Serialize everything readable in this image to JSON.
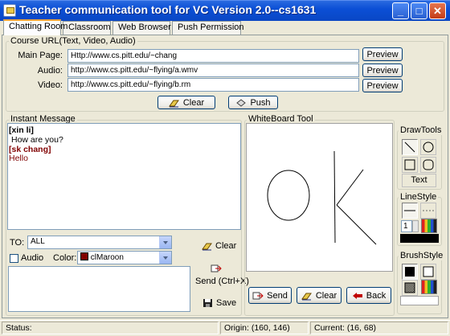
{
  "window": {
    "title": "Teacher communication tool for VC  Version 2.0--cs1631"
  },
  "tabs": [
    "Chatting Room",
    "Classroom",
    "Web Browser",
    "Push Permission"
  ],
  "course_url": {
    "group_label": "Course URL(Text, Video, Audio)",
    "main_page_label": "Main Page:",
    "main_page_value": "Http://www.cs.pitt.edu/~chang",
    "audio_label": "Audio:",
    "audio_value": "http://www.cs.pitt.edu/~flying/a.wmv",
    "video_label": "Video:",
    "video_value": "http://www.cs.pitt.edu/~flying/b.rm",
    "preview_label": "Preview",
    "clear_label": "Clear",
    "push_label": "Push"
  },
  "instant_message": {
    "group_label": "Instant Message",
    "messages": [
      {
        "sender": "[xin li]",
        "text": "How are you?",
        "color": "#000000"
      },
      {
        "sender": "[sk chang]",
        "text": "Hello",
        "color": "#800000"
      }
    ],
    "to_label": "TO:",
    "to_value": "ALL",
    "audio_checkbox_label": "Audio",
    "color_label": "Color:",
    "color_value": "clMaroon",
    "color_swatch": "#800000",
    "clear_label": "Clear",
    "send_label": "Send (Ctrl+X)",
    "save_label": "Save"
  },
  "whiteboard": {
    "group_label": "WhiteBoard Tool",
    "send_label": "Send",
    "clear_label": "Clear",
    "back_label": "Back"
  },
  "draw_tools": {
    "group_label": "DrawTools",
    "text_label": "Text",
    "tools": [
      "line-tool",
      "ellipse-tool",
      "rectangle-tool",
      "rounded-rect-tool"
    ]
  },
  "line_style": {
    "group_label": "LineStyle",
    "width_value": "1",
    "color": "#000000"
  },
  "brush_style": {
    "group_label": "BrushStyle",
    "color": "#ffffff"
  },
  "status": {
    "label": "Status:",
    "origin": "Origin: (160, 146)",
    "current": "Current: (16, 68)"
  },
  "colors": {
    "accent": "#0a47c4",
    "maroon": "#800000"
  }
}
